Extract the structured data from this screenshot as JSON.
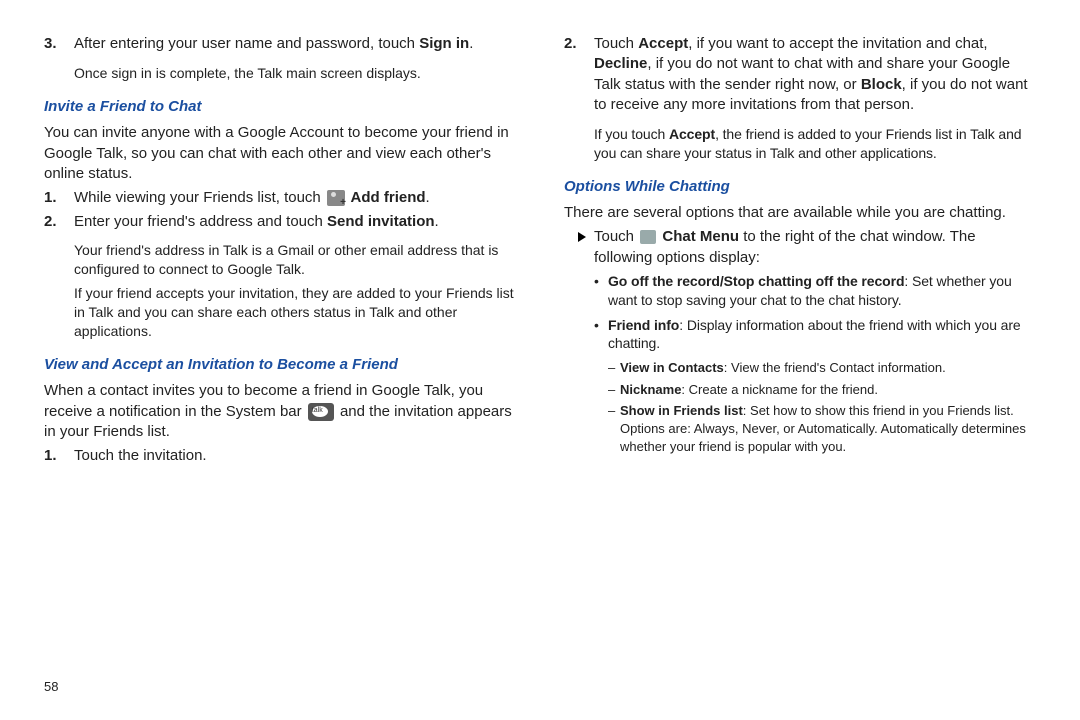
{
  "page_number": "58",
  "left": {
    "step3_num": "3.",
    "step3_a": "After entering your user name and password, touch ",
    "step3_b": "Sign in",
    "step3_c": ".",
    "step3_note": "Once sign in is complete, the Talk main screen displays.",
    "h_invite": "Invite a Friend to Chat",
    "invite_intro": "You can invite anyone with a Google Account to become your friend in Google Talk, so you can chat with each other and view each other's online status.",
    "i1_num": "1.",
    "i1_a": "While viewing your Friends list, touch ",
    "i1_b": " Add friend",
    "i1_c": ".",
    "i2_num": "2.",
    "i2_a": "Enter your friend's address and touch ",
    "i2_b": "Send invitation",
    "i2_c": ".",
    "i_note1": "Your friend's address in Talk is a Gmail or other email address that is configured to connect to Google Talk.",
    "i_note2": "If your friend accepts your invitation, they are added to your Friends list in Talk and you can share each others status in Talk and other applications.",
    "h_view": "View and Accept an Invitation to Become a Friend",
    "view_intro_a": "When a contact invites you to become a friend in Google Talk, you receive a notification in the System bar ",
    "view_intro_b": " and the invitation appears in your Friends list.",
    "v1_num": "1.",
    "v1_a": "Touch the invitation."
  },
  "right": {
    "v2_num": "2.",
    "v2_a": "Touch ",
    "v2_b": "Accept",
    "v2_c": ", if you want to accept the invitation and chat, ",
    "v2_d": "Decline",
    "v2_e": ", if you do not want to chat with and share your Google Talk status with the sender right now, or ",
    "v2_f": "Block",
    "v2_g": ", if you do not want to receive any more invitations from that person.",
    "v2_note_a": "If you touch ",
    "v2_note_b": "Accept",
    "v2_note_c": ", the friend is added to your Friends list in Talk and you can share your status in Talk and other applications.",
    "h_options": "Options While Chatting",
    "opt_intro": "There are several options that are available while you are chatting.",
    "touch_a": "Touch ",
    "touch_b": " Chat Menu",
    "touch_c": " to the right of the chat window. The following options display:",
    "b1_a": "Go off the record/Stop chatting off the record",
    "b1_b": ": Set whether you want to stop saving your chat to the chat history.",
    "b2_a": "Friend info",
    "b2_b": ": Display information about the friend with which you are chatting.",
    "d1_a": "View in Contacts",
    "d1_b": ": View the friend's Contact information.",
    "d2_a": "Nickname",
    "d2_b": ": Create a nickname for the friend.",
    "d3_a": "Show in Friends list",
    "d3_b": ": Set how to show this friend in you Friends list. Options are: Always, Never, or Automatically. Automatically determines whether your friend is popular with you."
  }
}
